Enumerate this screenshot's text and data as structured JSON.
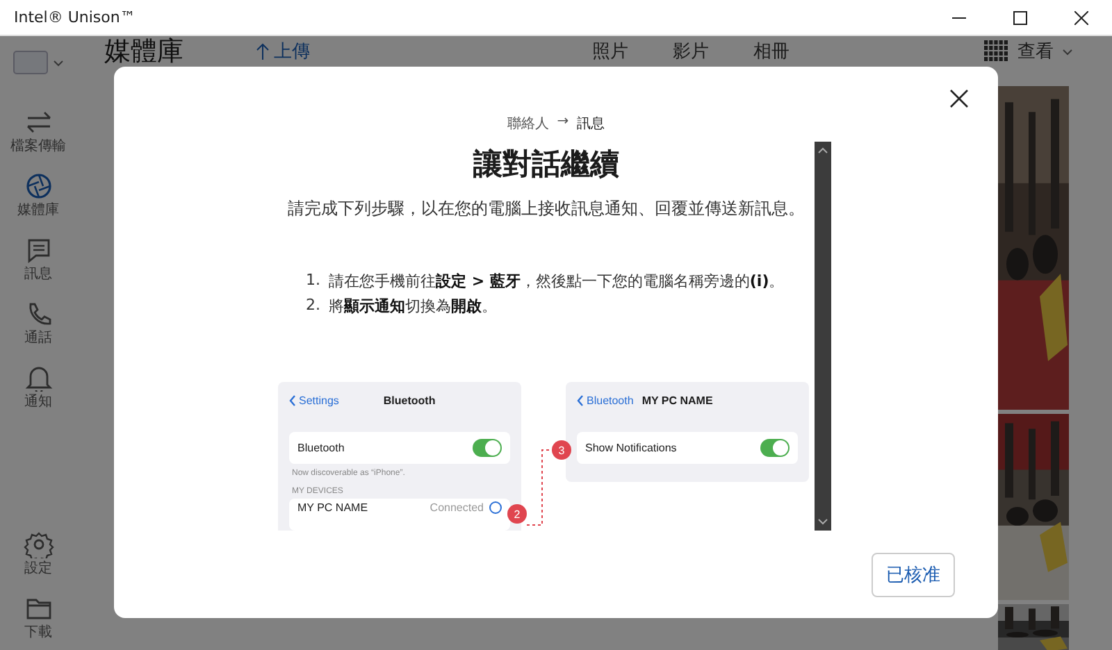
{
  "window": {
    "title": "Intel® Unison™"
  },
  "sidebar": {
    "items": [
      {
        "label": "檔案傳輸",
        "kind": "transfer",
        "selected": false
      },
      {
        "label": "媒體庫",
        "kind": "media",
        "selected": true
      },
      {
        "label": "訊息",
        "kind": "message",
        "selected": false
      },
      {
        "label": "通話",
        "kind": "call",
        "selected": false
      },
      {
        "label": "通知",
        "kind": "notify",
        "selected": false
      }
    ],
    "bottom_items": [
      {
        "label": "設定",
        "kind": "settings",
        "selected": false
      },
      {
        "label": "下載",
        "kind": "folder",
        "selected": false
      }
    ]
  },
  "header": {
    "title": "媒體庫",
    "upload": "上傳",
    "tabs": [
      "照片",
      "影片",
      "相冊"
    ],
    "view": "查看"
  },
  "dialog": {
    "breadcrumb": {
      "from": "聯絡人",
      "separator": "→",
      "to": "訊息"
    },
    "title": "讓對話繼續",
    "subtitle": "請完成下列步驟，以在您的電腦上接收訊息通知、回覆並傳送新訊息。",
    "steps": [
      {
        "number": "1.",
        "text": "請在您手機前往**設定 > 藍牙**，然後點一下您的電腦名稱旁邊的**(i)**。"
      },
      {
        "number": "2.",
        "text": "將**顯示通知**切換為**開啟**。"
      }
    ],
    "illustration": {
      "left_screen": {
        "back": "Settings",
        "title": "Bluetooth",
        "toggle_row": {
          "label": "Bluetooth",
          "on": true
        },
        "caption": "Now discoverable as “iPhone”.",
        "section": "MY DEVICES",
        "device": {
          "name": "MY PC NAME",
          "status": "Connected"
        }
      },
      "right_screen": {
        "back": "Bluetooth",
        "title": "MY PC NAME",
        "toggle_row": {
          "label": "Show Notifications",
          "on": true
        }
      },
      "badges": [
        "2",
        "3"
      ]
    },
    "button": "已核准"
  }
}
